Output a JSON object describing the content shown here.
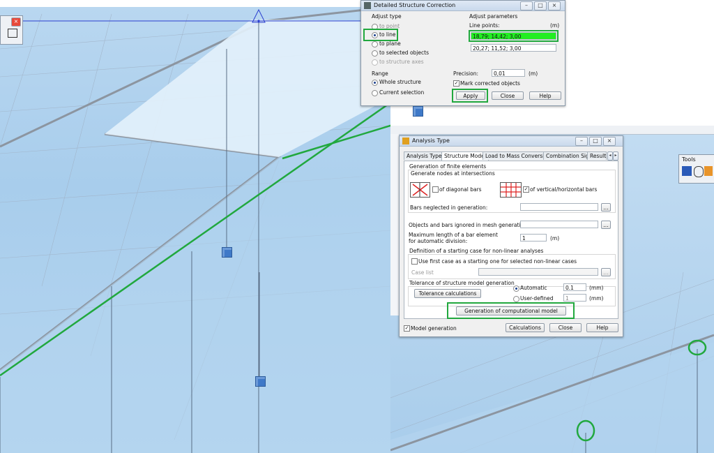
{
  "dsc": {
    "title": "Detailed Structure Correction",
    "adjust_type_label": "Adjust type",
    "options": [
      "to point",
      "to line",
      "to plane",
      "to selected objects",
      "to structure axes"
    ],
    "adjust_params_label": "Adjust parameters",
    "line_points_label": "Line points:",
    "unit_m": "(m)",
    "line_point_1": "18,79; 14,42; 3,00",
    "line_point_2": "20,27; 11,52; 3,00",
    "range_label": "Range",
    "range_options": [
      "Whole structure",
      "Current selection"
    ],
    "precision_label": "Precision:",
    "precision_value": "0,01",
    "mark_label": "Mark corrected objects",
    "apply": "Apply",
    "close": "Close",
    "help": "Help"
  },
  "analysis": {
    "title": "Analysis Type",
    "tabs": [
      "Analysis Types",
      "Structure Model",
      "Load to Mass Conversion",
      "Combination Sign",
      "Result I"
    ],
    "gen_fe_label": "Generation of finite elements",
    "gen_nodes_label": "Generate nodes at intersections",
    "diag_label": "of diagonal bars",
    "vh_label": "of vertical/horizontal bars",
    "bars_neglected": "Bars neglected in generation:",
    "objects_ignored": "Objects and bars ignored in mesh generation:",
    "max_length_1": "Maximum length of a bar element",
    "max_length_2": "for automatic division:",
    "max_length_value": "1",
    "unit_m": "(m)",
    "starting_case_label": "Definition of a starting case for non-linear analyses",
    "use_first_case": "Use first case as a starting one for selected non-linear cases",
    "case_list": "Case list",
    "tolerance_label": "Tolerance of structure model generation",
    "tolerance_button": "Tolerance calculations",
    "automatic": "Automatic",
    "automatic_value": "0.1",
    "user_defined": "User-defined",
    "user_defined_value": "1",
    "unit_mm": "(mm)",
    "gen_model_button": "Generation of computational model",
    "model_generation": "Model generation",
    "calculations": "Calculations",
    "close": "Close",
    "help": "Help",
    "dots": "..."
  },
  "tools": {
    "title": "Tools"
  },
  "colors": {
    "highlight": "#21a83e",
    "line_point_active": "#22ee22",
    "cube": "#3f79c8"
  }
}
